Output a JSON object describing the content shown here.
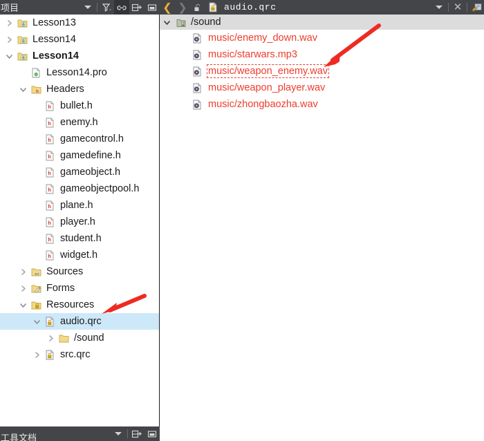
{
  "toolbar_left": {
    "title_cn": "项目",
    "dropdown_icon": "chevron-down-icon",
    "filter_icon": "filter-icon",
    "link_icon": "link-icon",
    "split_icon": "split-add-icon",
    "close_pane_icon": "close-pane-icon"
  },
  "toolbar_right": {
    "back_icon": "back-arrow-icon",
    "forward_icon": "forward-arrow-icon",
    "unlock_icon": "unlock-icon",
    "file_icon": "qrc-lock-file-icon",
    "document_title": "audio.qrc",
    "dropdown_icon": "chevron-down-icon",
    "close_icon": "close-icon",
    "extra_icon": "split-editor-icon"
  },
  "bottombar_left": {
    "title_cn": "工具文档",
    "dropdown_icon": "chevron-down-icon",
    "split_icon": "split-add-icon",
    "close_pane_icon": "close-pane-icon"
  },
  "sidebar": {
    "items": [
      {
        "label": "Lesson13",
        "indent": 0,
        "twisty": "collapsed",
        "icon": "qt-project-folder-icon",
        "bold": false,
        "selected": false
      },
      {
        "label": "Lesson14",
        "indent": 0,
        "twisty": "collapsed",
        "icon": "qt-project-folder-icon",
        "bold": false,
        "selected": false
      },
      {
        "label": "Lesson14",
        "indent": 0,
        "twisty": "expanded",
        "icon": "qt-project-folder-icon",
        "bold": true,
        "selected": false
      },
      {
        "label": "Lesson14.pro",
        "indent": 1,
        "twisty": "none",
        "icon": "qt-pro-file-icon",
        "bold": false,
        "selected": false
      },
      {
        "label": "Headers",
        "indent": 1,
        "twisty": "expanded",
        "icon": "headers-folder-icon",
        "bold": false,
        "selected": false
      },
      {
        "label": "bullet.h",
        "indent": 2,
        "twisty": "none",
        "icon": "header-file-icon",
        "bold": false,
        "selected": false
      },
      {
        "label": "enemy.h",
        "indent": 2,
        "twisty": "none",
        "icon": "header-file-icon",
        "bold": false,
        "selected": false
      },
      {
        "label": "gamecontrol.h",
        "indent": 2,
        "twisty": "none",
        "icon": "header-file-icon",
        "bold": false,
        "selected": false
      },
      {
        "label": "gamedefine.h",
        "indent": 2,
        "twisty": "none",
        "icon": "header-file-icon",
        "bold": false,
        "selected": false
      },
      {
        "label": "gameobject.h",
        "indent": 2,
        "twisty": "none",
        "icon": "header-file-icon",
        "bold": false,
        "selected": false
      },
      {
        "label": "gameobjectpool.h",
        "indent": 2,
        "twisty": "none",
        "icon": "header-file-icon",
        "bold": false,
        "selected": false
      },
      {
        "label": "plane.h",
        "indent": 2,
        "twisty": "none",
        "icon": "header-file-icon",
        "bold": false,
        "selected": false
      },
      {
        "label": "player.h",
        "indent": 2,
        "twisty": "none",
        "icon": "header-file-icon",
        "bold": false,
        "selected": false
      },
      {
        "label": "student.h",
        "indent": 2,
        "twisty": "none",
        "icon": "header-file-icon",
        "bold": false,
        "selected": false
      },
      {
        "label": "widget.h",
        "indent": 2,
        "twisty": "none",
        "icon": "header-file-icon",
        "bold": false,
        "selected": false
      },
      {
        "label": "Sources",
        "indent": 1,
        "twisty": "collapsed",
        "icon": "sources-folder-icon",
        "bold": false,
        "selected": false
      },
      {
        "label": "Forms",
        "indent": 1,
        "twisty": "collapsed",
        "icon": "forms-folder-icon",
        "bold": false,
        "selected": false
      },
      {
        "label": "Resources",
        "indent": 1,
        "twisty": "expanded",
        "icon": "resources-folder-icon",
        "bold": false,
        "selected": false
      },
      {
        "label": "audio.qrc",
        "indent": 2,
        "twisty": "expanded",
        "icon": "qrc-file-icon",
        "bold": false,
        "selected": true
      },
      {
        "label": "/sound",
        "indent": 3,
        "twisty": "collapsed",
        "icon": "plain-folder-icon",
        "bold": false,
        "selected": false
      },
      {
        "label": "src.qrc",
        "indent": 2,
        "twisty": "collapsed",
        "icon": "qrc-file-icon",
        "bold": false,
        "selected": false
      }
    ]
  },
  "resource_panel": {
    "group": {
      "label": "/sound",
      "twisty": "expanded",
      "icon": "resource-prefix-icon"
    },
    "files": [
      {
        "label": "music/enemy_down.wav",
        "icon": "audio-file-icon",
        "focused": false
      },
      {
        "label": "music/starwars.mp3",
        "icon": "audio-file-icon",
        "focused": false
      },
      {
        "label": "music/weapon_enemy.wav",
        "icon": "audio-file-icon",
        "focused": true
      },
      {
        "label": "music/weapon_player.wav",
        "icon": "audio-file-icon",
        "focused": false
      },
      {
        "label": "music/zhongbaozha.wav",
        "icon": "audio-file-icon",
        "focused": false
      }
    ]
  },
  "annotations": {
    "arrow_color": "#ee2b22",
    "arrow_top_name": "red-arrow-pointing-to-starwars-row",
    "arrow_left_name": "red-arrow-pointing-to-audio-qrc-row"
  },
  "colors": {
    "toolbar_bg": "#444548",
    "selection_bg": "#cde8f8",
    "group_bg": "#dcdcdc",
    "file_text": "#ef3b2c",
    "tree_text": "#1a1a1a"
  }
}
